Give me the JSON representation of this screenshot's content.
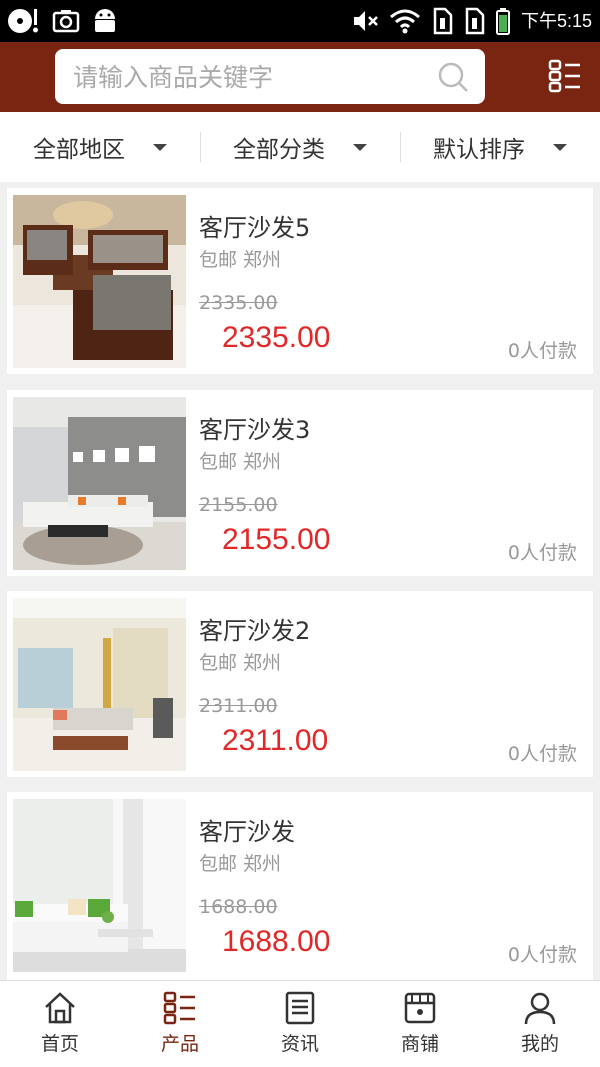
{
  "status_bar": {
    "time": "下午5:15",
    "icons": [
      "music-disc-icon",
      "camera-icon",
      "android-icon",
      "mute-icon",
      "wifi-icon",
      "sim1-icon",
      "sim2-icon",
      "battery-icon"
    ]
  },
  "search": {
    "placeholder": "请输入商品关键字"
  },
  "filters": [
    {
      "label": "全部地区"
    },
    {
      "label": "全部分类"
    },
    {
      "label": "默认排序"
    }
  ],
  "products": [
    {
      "title": "客厅沙发5",
      "tags": "包邮 郑州",
      "old_price": "2335.00",
      "price": "2335.00",
      "paid": "0人付款"
    },
    {
      "title": "客厅沙发3",
      "tags": "包邮 郑州",
      "old_price": "2155.00",
      "price": "2155.00",
      "paid": "0人付款"
    },
    {
      "title": "客厅沙发2",
      "tags": "包邮 郑州",
      "old_price": "2311.00",
      "price": "2311.00",
      "paid": "0人付款"
    },
    {
      "title": "客厅沙发",
      "tags": "包邮 郑州",
      "old_price": "1688.00",
      "price": "1688.00",
      "paid": "0人付款"
    }
  ],
  "bottom_nav": [
    {
      "label": "首页",
      "icon": "home-icon"
    },
    {
      "label": "产品",
      "icon": "grid-list-icon",
      "active": true
    },
    {
      "label": "资讯",
      "icon": "news-icon"
    },
    {
      "label": "商铺",
      "icon": "store-icon"
    },
    {
      "label": "我的",
      "icon": "user-icon"
    }
  ],
  "colors": {
    "brand": "#7a2512",
    "price": "#e12727"
  }
}
